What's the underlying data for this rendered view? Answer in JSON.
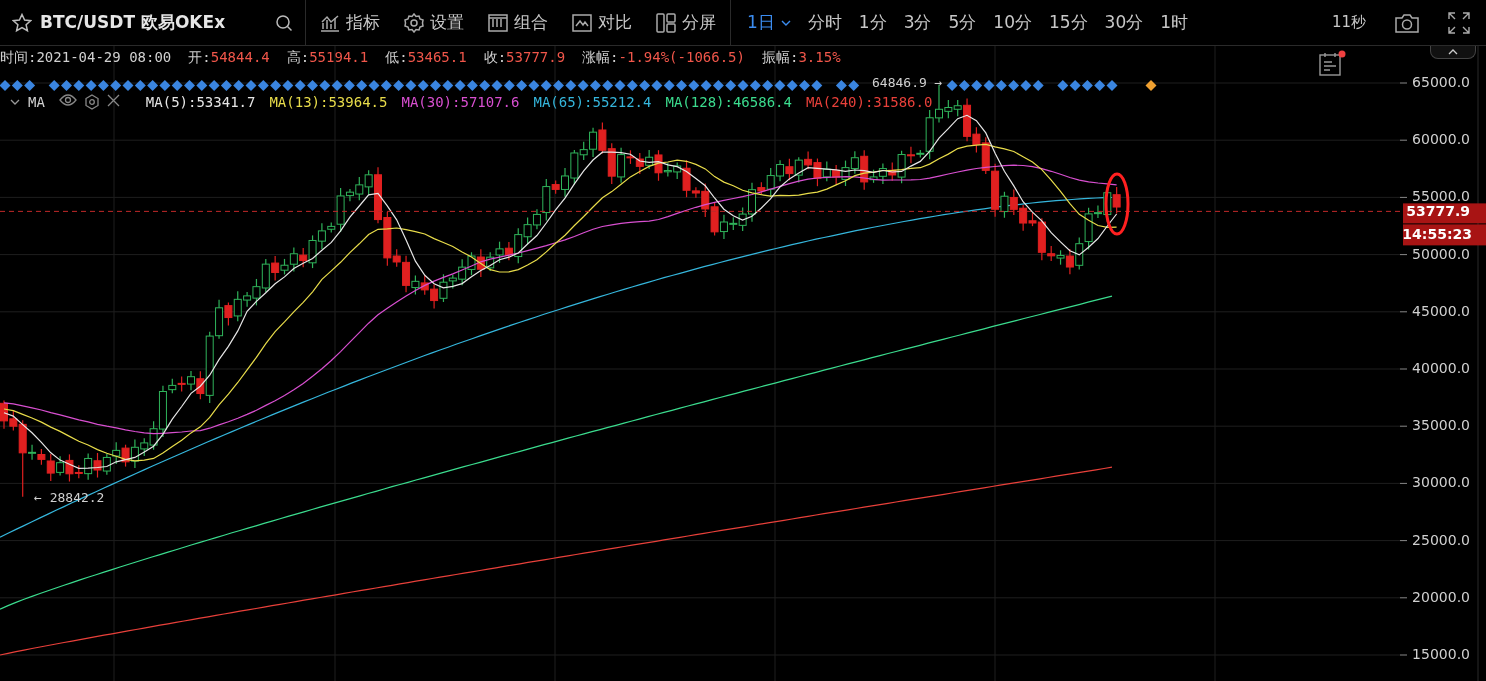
{
  "header": {
    "symbol": "BTC/USDT 欧易OKEx"
  },
  "tools": [
    {
      "label": "指标",
      "kind": "indicators"
    },
    {
      "label": "设置",
      "kind": "settings"
    },
    {
      "label": "组合",
      "kind": "layout"
    },
    {
      "label": "对比",
      "kind": "compare"
    },
    {
      "label": "分屏",
      "kind": "split"
    }
  ],
  "intervals": [
    {
      "label": "1日",
      "selected": true
    },
    {
      "label": "分时",
      "selected": false
    },
    {
      "label": "1分",
      "selected": false
    },
    {
      "label": "3分",
      "selected": false
    },
    {
      "label": "5分",
      "selected": false
    },
    {
      "label": "10分",
      "selected": false
    },
    {
      "label": "15分",
      "selected": false
    },
    {
      "label": "30分",
      "selected": false
    },
    {
      "label": "1时",
      "selected": false
    }
  ],
  "refresh": "11秒",
  "info": [
    {
      "label": "时间:",
      "value": "2021-04-29 08:00",
      "kind": "plain"
    },
    {
      "label": "开:",
      "value": "54844.4",
      "kind": "price"
    },
    {
      "label": "高:",
      "value": "55194.1",
      "kind": "price"
    },
    {
      "label": "低:",
      "value": "53465.1",
      "kind": "price"
    },
    {
      "label": "收:",
      "value": "53777.9",
      "kind": "price"
    },
    {
      "label": "涨幅:",
      "value": "-1.94%(-1066.5)",
      "kind": "price"
    },
    {
      "label": "振幅:",
      "value": "3.15%",
      "kind": "price"
    }
  ],
  "indicator": {
    "name": "MA",
    "items": [
      {
        "label": "MA(5):53341.7",
        "color": "#e6e6e6"
      },
      {
        "label": "MA(13):53964.5",
        "color": "#e8dc4a"
      },
      {
        "label": "MA(30):57107.6",
        "color": "#d84fd0"
      },
      {
        "label": "MA(65):55212.4",
        "color": "#35b6dc"
      },
      {
        "label": "MA(128):46586.4",
        "color": "#3bdc8e"
      },
      {
        "label": "MA(240):31586.0",
        "color": "#e8403a"
      }
    ]
  },
  "chart": {
    "y_axis": [
      "65000.0",
      "60000.0",
      "55000.0",
      "50000.0",
      "45000.0",
      "40000.0",
      "35000.0",
      "30000.0",
      "25000.0",
      "20000.0",
      "15000.0"
    ],
    "last_price": "53777.9",
    "countdown": "14:55:23",
    "high_marker": "64846.9 →",
    "low_marker": "← 28842.2"
  }
}
